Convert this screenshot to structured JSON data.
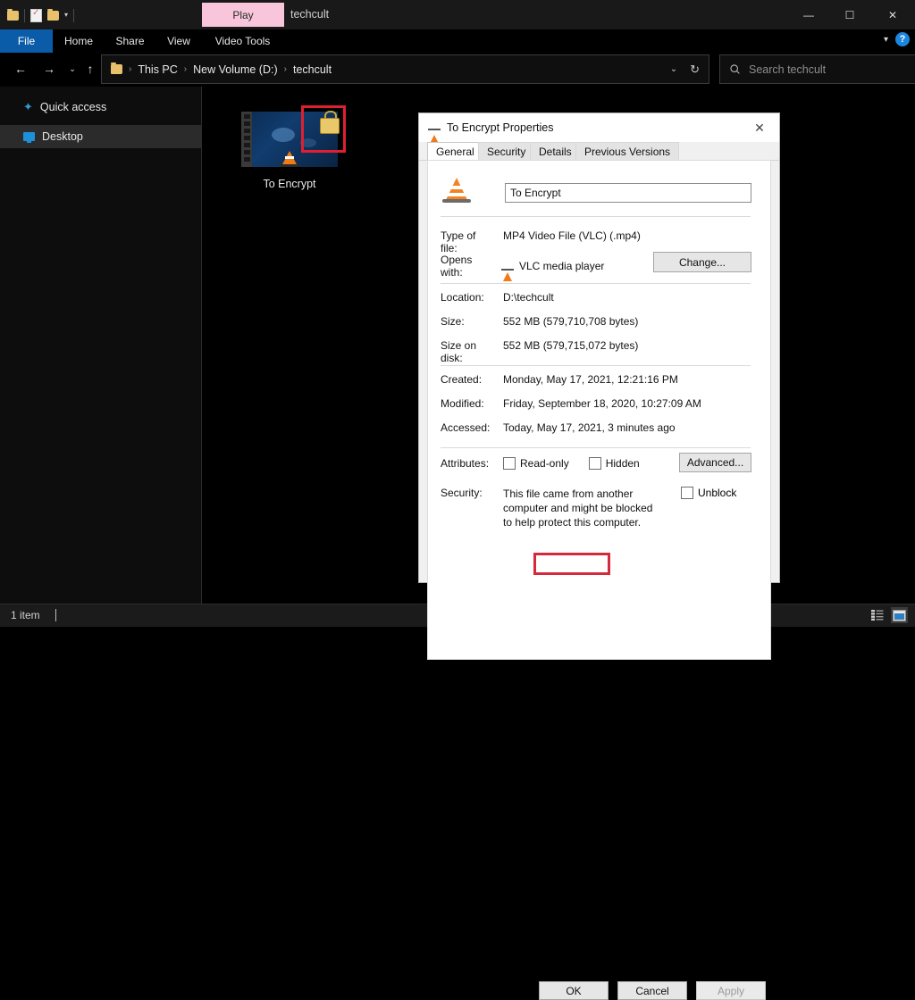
{
  "window": {
    "title": "techcult",
    "quick_access_tools": [
      "folder-icon",
      "properties-icon",
      "new-folder-icon",
      "customize-caret"
    ],
    "contextual_tab": "Play",
    "controls": {
      "minimize": "—",
      "maximize": "❐",
      "close": "✕"
    }
  },
  "ribbon": {
    "tabs": [
      {
        "label": "File",
        "id": "file"
      },
      {
        "label": "Home",
        "id": "home"
      },
      {
        "label": "Share",
        "id": "share"
      },
      {
        "label": "View",
        "id": "view"
      },
      {
        "label": "Video Tools",
        "id": "video-tools"
      }
    ],
    "collapse_caret": "⌄",
    "help_label": "?"
  },
  "address": {
    "back": "←",
    "forward": "→",
    "recent": "⌄",
    "up": "↑",
    "breadcrumbs": [
      "This PC",
      "New Volume (D:)",
      "techcult"
    ],
    "separator": "›",
    "dropdown": "⌄",
    "refresh": "↻"
  },
  "search": {
    "placeholder": "Search techcult",
    "icon": "search-icon"
  },
  "sidebar": {
    "items": [
      {
        "label": "Quick access",
        "icon": "star-icon",
        "selected": false
      },
      {
        "label": "Desktop",
        "icon": "monitor-icon",
        "selected": true
      }
    ]
  },
  "files": [
    {
      "name": "To Encrypt",
      "badge": "lock-icon",
      "overlay": "vlc-cone-icon",
      "highlighted": true
    }
  ],
  "status": {
    "item_count": "1 item",
    "views": [
      "details-view-icon",
      "large-icons-view-icon"
    ]
  },
  "dialog": {
    "title": "To Encrypt Properties",
    "close": "✕",
    "tabs": [
      {
        "label": "General",
        "active": true
      },
      {
        "label": "Security",
        "active": false
      },
      {
        "label": "Details",
        "active": false
      },
      {
        "label": "Previous Versions",
        "active": false
      }
    ],
    "filename_value": "To Encrypt",
    "fields": [
      {
        "label": "Type of file:",
        "value": "MP4 Video File (VLC) (.mp4)"
      },
      {
        "label": "Opens with:",
        "value": "VLC media player"
      },
      {
        "label": "Location:",
        "value": "D:\\techcult"
      },
      {
        "label": "Size:",
        "value": "552 MB (579,710,708 bytes)"
      },
      {
        "label": "Size on disk:",
        "value": "552 MB (579,715,072 bytes)"
      },
      {
        "label": "Created:",
        "value": "Monday, May 17, 2021, 12:21:16 PM"
      },
      {
        "label": "Modified:",
        "value": "Friday, September 18, 2020, 10:27:09 AM"
      },
      {
        "label": "Accessed:",
        "value": "Today, May 17, 2021, 3 minutes ago"
      }
    ],
    "change_button": "Change...",
    "attributes_label": "Attributes:",
    "attributes": [
      {
        "label": "Read-only",
        "checked": false
      },
      {
        "label": "Hidden",
        "checked": false
      }
    ],
    "advanced_button": "Advanced...",
    "security_label": "Security:",
    "security_text": "This file came from another computer and might be blocked to help protect this computer.",
    "unblock_label": "Unblock",
    "unblock_checked": false,
    "buttons": {
      "ok": "OK",
      "cancel": "Cancel",
      "apply": "Apply",
      "apply_disabled": true,
      "ok_highlighted": true
    }
  },
  "colors": {
    "accent": "#0b5ca8",
    "contextual_tab": "#f9c5da",
    "highlight_box": "#e02030",
    "vlc_orange": "#f5821f"
  }
}
